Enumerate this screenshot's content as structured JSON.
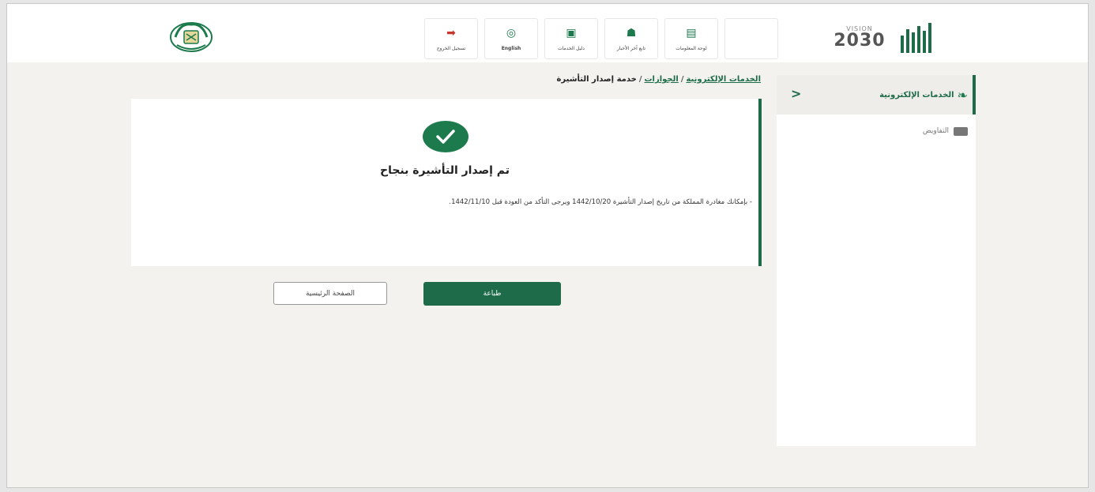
{
  "header": {
    "vision": {
      "top": "VISION",
      "number": "2030",
      "bottom": ""
    },
    "nav": [
      {
        "label": "تسجيل الخروج",
        "icon": "logout-icon"
      },
      {
        "label": "English",
        "icon": "globe-icon"
      },
      {
        "label": "دليل الخدمات",
        "icon": "guide-icon"
      },
      {
        "label": "تابع آخر الأخبار",
        "icon": "news-icon"
      },
      {
        "label": "لوحة المعلومات",
        "icon": "dashboard-icon"
      }
    ]
  },
  "sidebar": {
    "active_item": "الخدمات الإلكترونية",
    "items": [
      {
        "label": "التفاويض"
      }
    ]
  },
  "breadcrumb": {
    "level1": "الخدمات الإلكترونية",
    "level2": "الجوازات",
    "current": "خدمة إصدار التأشيرة"
  },
  "result": {
    "title": "تم إصدار التأشيرة بنجاح",
    "message": "- بإمكانك مغادرة المملكة من تاريخ إصدار التأشيرة 1442/10/20 ويرجى التأكد من العودة قبل 1442/11/10."
  },
  "buttons": {
    "print": "طباعة",
    "home": "الصفحة الرئيسية"
  },
  "colors": {
    "brand_green": "#1d6b48",
    "logout_red": "#c8372d"
  }
}
